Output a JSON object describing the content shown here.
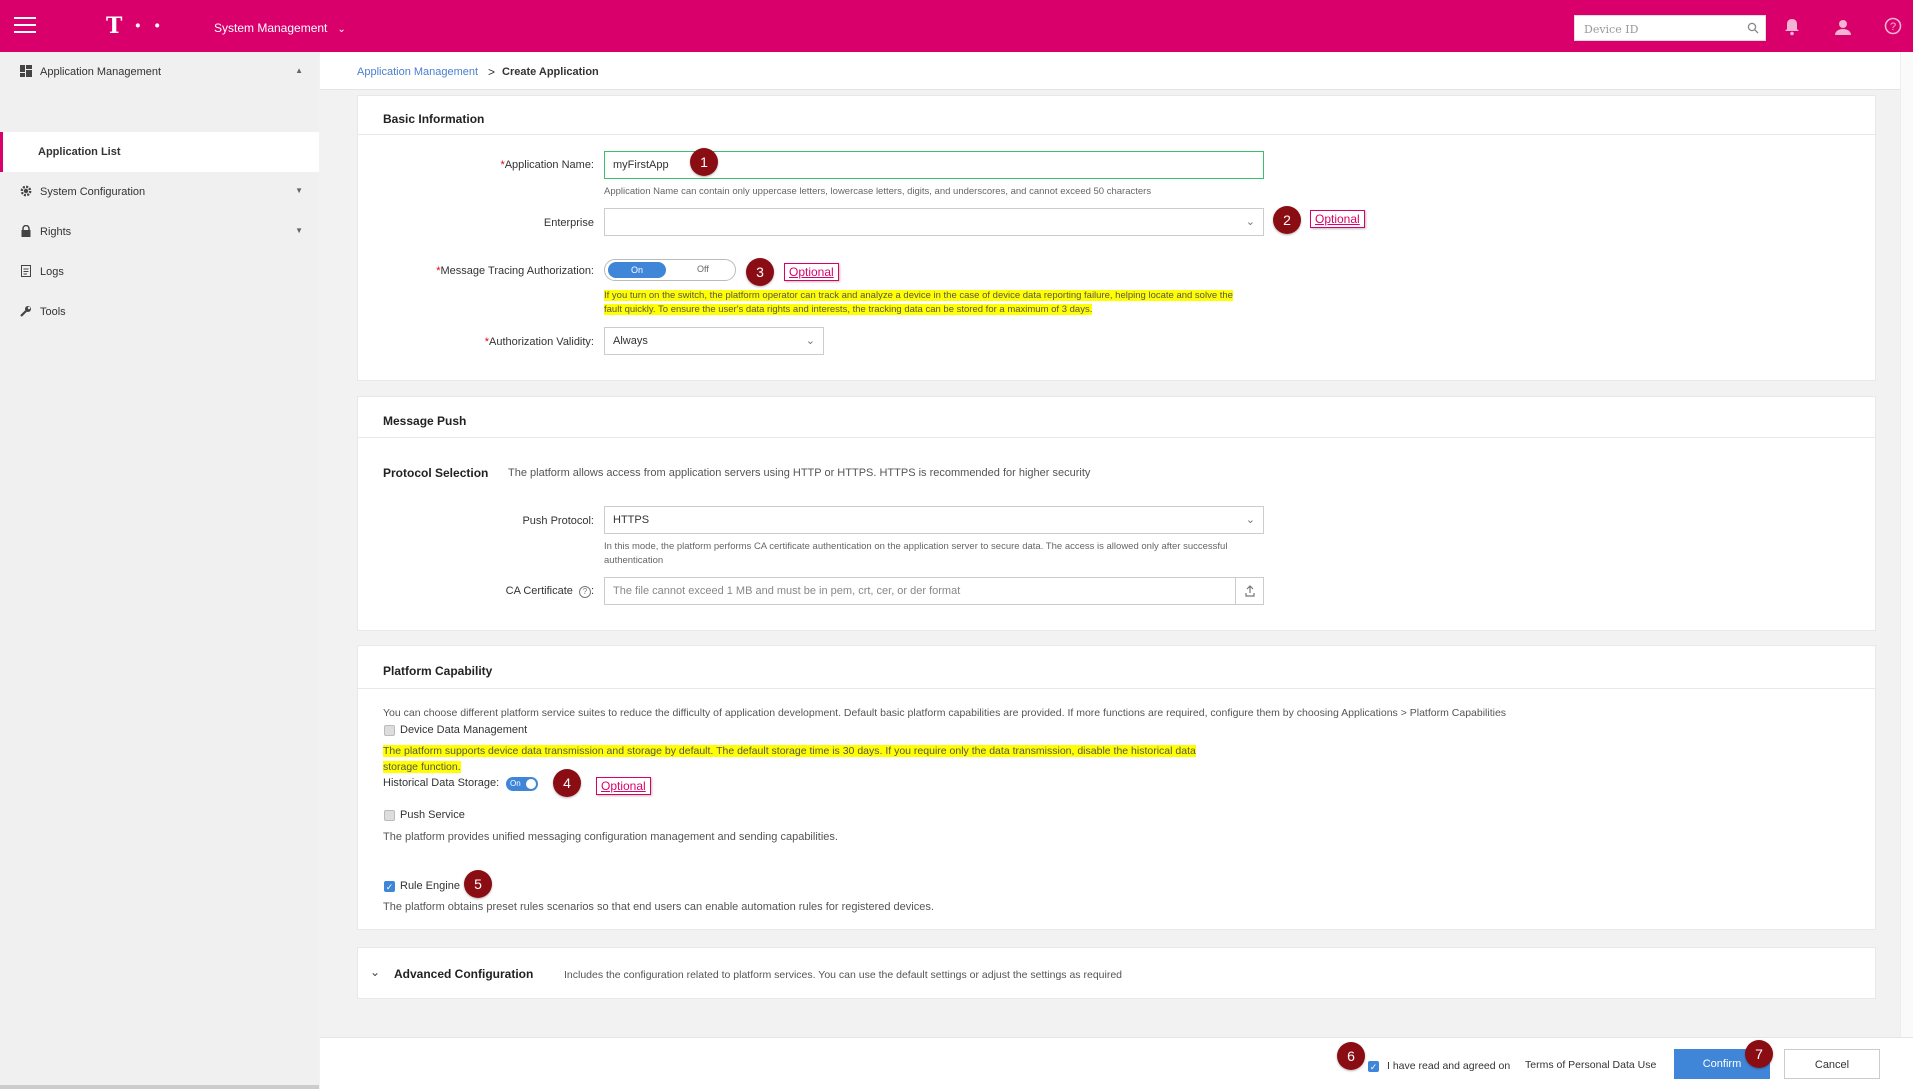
{
  "topbar": {
    "logo": "T · ·",
    "system_menu": "System Management",
    "search_placeholder": "Device ID"
  },
  "sidebar": {
    "items": [
      {
        "label": "Application Management"
      },
      {
        "label": "System Configuration"
      },
      {
        "label": "Rights"
      },
      {
        "label": "Logs"
      },
      {
        "label": "Tools"
      }
    ],
    "active_sub": "Application List"
  },
  "breadcrumb": {
    "parent": "Application Management",
    "separator": ">",
    "current": "Create Application"
  },
  "basic": {
    "title": "Basic Information",
    "app_name_label": "Application Name:",
    "app_name_value": "myFirstApp",
    "app_name_hint": "Application Name can contain only uppercase letters, lowercase letters, digits, and underscores, and cannot exceed 50 characters",
    "enterprise_label": "Enterprise",
    "enterprise_value": "",
    "tracing_label": "Message Tracing Authorization:",
    "toggle_on": "On",
    "toggle_off": "Off",
    "tracing_hint_1": "If you turn on the switch, the platform operator can track and analyze a device in the case of device data reporting failure, helping locate and solve the",
    "tracing_hint_2": "fault quickly. To ensure the user's data rights and interests, the tracking data can be stored for a maximum of 3 days.",
    "validity_label": "Authorization Validity:",
    "validity_value": "Always",
    "required_mark": "*"
  },
  "push": {
    "title": "Message Push",
    "protocol_title": "Protocol Selection",
    "protocol_desc": "The platform allows access from application servers using HTTP or HTTPS. HTTPS is recommended for higher security",
    "push_protocol_label": "Push Protocol:",
    "push_protocol_value": "HTTPS",
    "protocol_hint_1": "In this mode, the platform performs CA certificate authentication on the application server to secure data. The access is allowed only after successful",
    "protocol_hint_2": "authentication",
    "ca_label": "CA Certificate",
    "ca_colon": ":",
    "ca_help": "?",
    "ca_placeholder": "The file cannot exceed 1 MB and must be in pem, crt, cer, or der format"
  },
  "capability": {
    "title": "Platform Capability",
    "intro": "You can choose different platform service suites to reduce the difficulty of application development. Default basic platform capabilities are provided. If more functions are required, configure them by choosing Applications > Platform Capabilities",
    "ddm_label": "Device Data Management",
    "ddm_hint_1": "The platform supports device data transmission and storage by default. The default storage time is 30 days. If you require only the data transmission, disable the historical data",
    "ddm_hint_2": "storage function.",
    "hds_label": "Historical Data Storage:",
    "hds_toggle": "On",
    "push_label": "Push Service",
    "push_desc": "The platform provides unified messaging configuration management and sending capabilities.",
    "rule_label": "Rule Engine",
    "rule_desc": "The platform obtains preset rules scenarios so that end users can enable automation rules for registered devices.",
    "check_mark": "✓"
  },
  "advanced": {
    "title": "Advanced Configuration",
    "desc": "Includes the configuration related to platform services. You can use the default settings or adjust the settings as required"
  },
  "footer": {
    "agree_text": "I have read and agreed on",
    "terms_link": "Terms of Personal Data Use",
    "confirm": "Confirm",
    "cancel": "Cancel"
  },
  "annotations": {
    "optional": "Optional",
    "markers": [
      "1",
      "2",
      "3",
      "4",
      "5",
      "6",
      "7"
    ]
  },
  "colors": {
    "brand": "#d9006c",
    "primary": "#3f86d8",
    "marker": "#8b0d14",
    "highlight": "#ffff00"
  }
}
